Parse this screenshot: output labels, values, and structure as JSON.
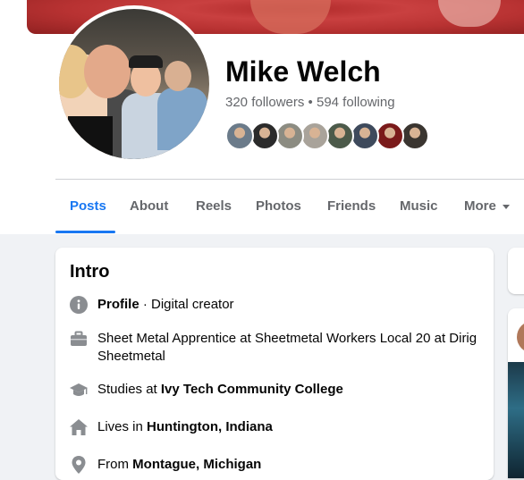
{
  "profile": {
    "name": "Mike Welch",
    "followers_text": "320 followers",
    "separator": " • ",
    "following_text": "594 following"
  },
  "friend_avatars": [
    {
      "name": "friend-1",
      "color": "#6b7b8a"
    },
    {
      "name": "friend-2",
      "color": "#2b2b2b"
    },
    {
      "name": "friend-3",
      "color": "#8c8c82"
    },
    {
      "name": "friend-4",
      "color": "#a9a39a"
    },
    {
      "name": "friend-5",
      "color": "#4c5a4a"
    },
    {
      "name": "friend-6",
      "color": "#3e4a5c"
    },
    {
      "name": "friend-7",
      "color": "#7a1a1a"
    },
    {
      "name": "friend-8",
      "color": "#3a3530"
    }
  ],
  "tabs": [
    {
      "label": "Posts",
      "active": true
    },
    {
      "label": "About"
    },
    {
      "label": "Reels"
    },
    {
      "label": "Photos"
    },
    {
      "label": "Friends"
    },
    {
      "label": "Music"
    },
    {
      "label": "More"
    }
  ],
  "intro": {
    "title": "Intro",
    "profile_label": "Profile",
    "profile_value": " · Digital creator",
    "work": "Sheet Metal Apprentice at Sheetmetal Workers Local 20 at Dirig Sheetmetal",
    "studies_prefix": "Studies at ",
    "studies_school": "Ivy Tech Community College",
    "lives_prefix": "Lives in ",
    "lives_place": "Huntington, Indiana",
    "from_prefix": "From ",
    "from_place": "Montague, Michigan"
  },
  "colors": {
    "accent": "#1877f2",
    "icon_gray": "#65676b"
  }
}
